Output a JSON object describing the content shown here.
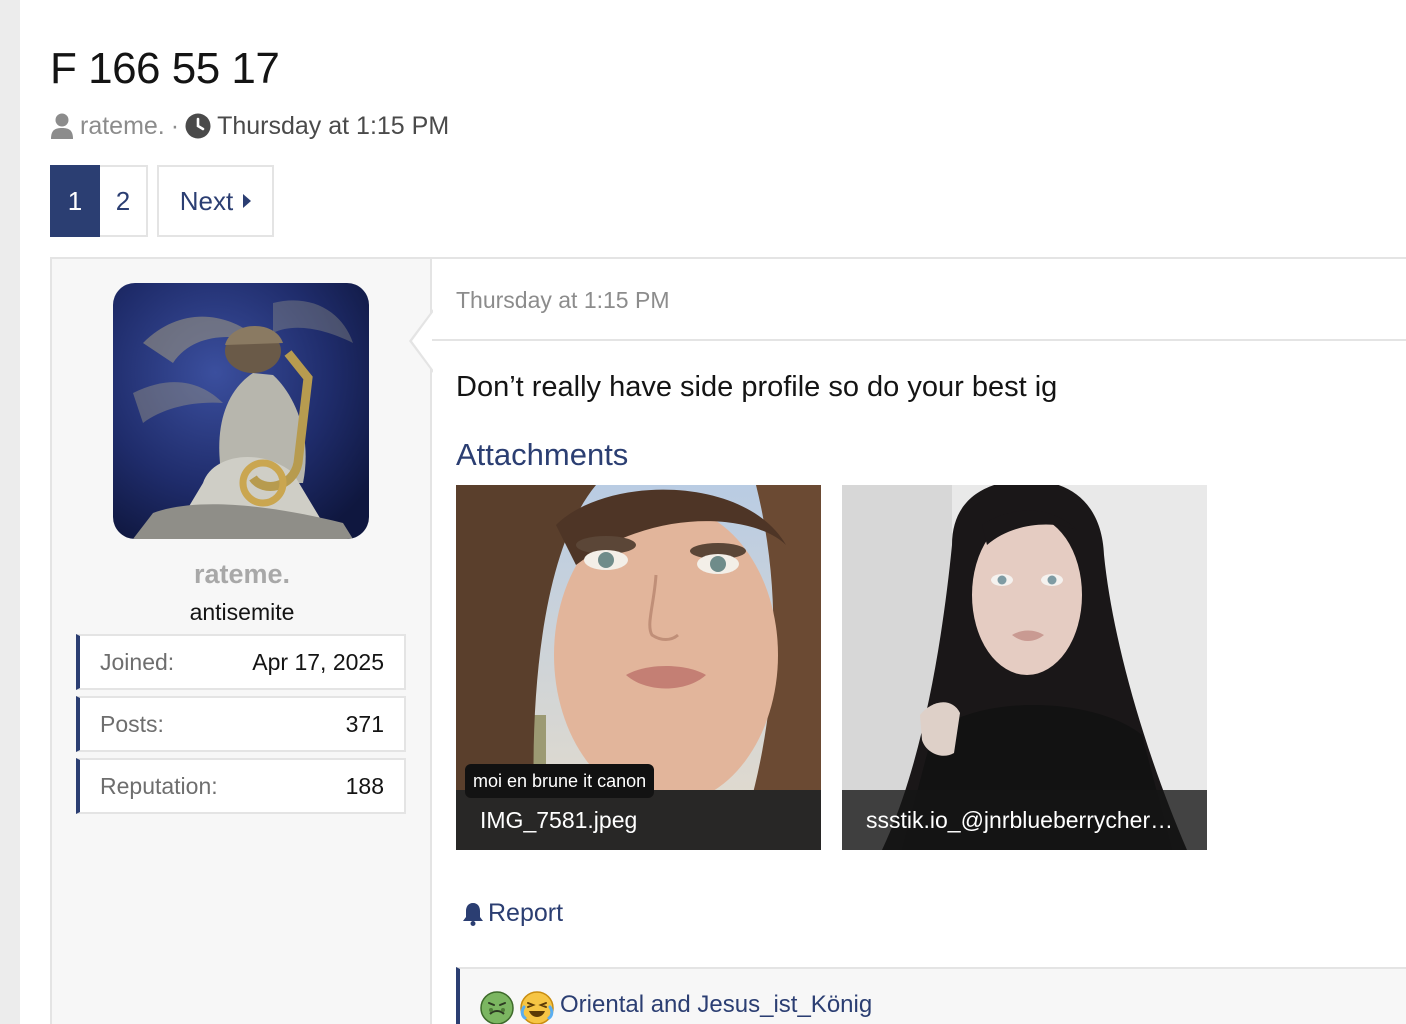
{
  "thread": {
    "title": "F 166 55 17",
    "author": "rateme.",
    "separator": "·",
    "date": "Thursday at 1:15 PM"
  },
  "pagination": {
    "pages": [
      "1",
      "2"
    ],
    "current": "1",
    "next_label": "Next"
  },
  "post": {
    "user": {
      "name": "rateme.",
      "title": "antisemite",
      "stats": [
        {
          "label": "Joined:",
          "value": "Apr 17, 2025"
        },
        {
          "label": "Posts:",
          "value": "371"
        },
        {
          "label": "Reputation:",
          "value": "188"
        }
      ]
    },
    "date": "Thursday at 1:15 PM",
    "body": "Don’t really have side profile so do your best ig",
    "attachments_heading": "Attachments",
    "attachments": [
      {
        "filename": "IMG_7581.jpeg",
        "overlay_text": "moi en brune it canon"
      },
      {
        "filename": "ssstik.io_@jnrblueberrycher…"
      }
    ],
    "report_label": "Report",
    "reactions": {
      "icons": [
        "nauseated-face-emoji",
        "crying-laughing-emoji"
      ],
      "names": "Oriental and Jesus_ist_König"
    }
  },
  "colors": {
    "accent": "#2b3e72",
    "muted": "#8c8c8c",
    "border": "#e4e4e4",
    "sidebar_bg": "#f7f7f7"
  }
}
